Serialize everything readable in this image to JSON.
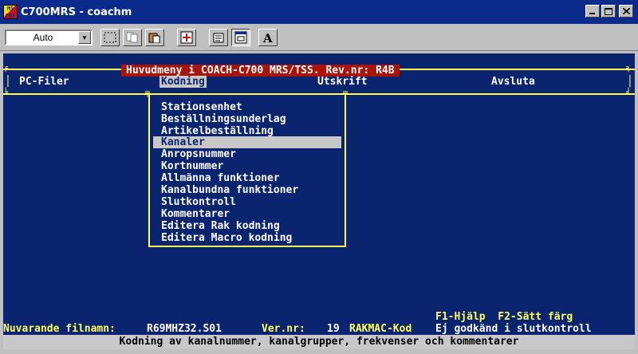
{
  "window": {
    "title": "C700MRS - coachm",
    "icon_label": "MS DOS"
  },
  "toolbar": {
    "font_size_value": "Auto",
    "buttons": [
      "mark-icon",
      "copy-icon",
      "paste-icon",
      "fullscreen-icon",
      "properties-icon",
      "background-icon",
      "font-icon"
    ]
  },
  "console": {
    "header": "Huvudmeny i COACH-C700 MRS/TSS. Rev.nr: R4B",
    "menu": [
      "PC-Filer",
      "Kodning",
      "Utskrift",
      "Avsluta"
    ],
    "dropdown": [
      "Stationsenhet",
      "Beställningsunderlag",
      "Artikelbeställning",
      "Kanaler",
      "Anropsnummer",
      "Kortnummer",
      "Allmänna funktioner",
      "Kanalbundna funktioner",
      "Slutkontroll",
      "Kommentarer",
      "Editera Rak kodning",
      "Editera Macro kodning"
    ],
    "selected_index": 3,
    "fkeys": "F1-Hjälp  F2-Sätt färg",
    "file_line": {
      "label": "Nuvarande filnamn:",
      "filename": "R69MHZ32.S01",
      "ver_label": "Ver.nr:",
      "ver_value": "19",
      "mode": "RAKMAC-Kod",
      "status": "Ej godkänd i slutkontroll"
    },
    "status_hint": "Kodning av kanalnummer, kanalgrupper, frekvenser och kommentarer"
  },
  "colors": {
    "console_bg": "#0b2470",
    "highlight_yellow": "#ffff55",
    "header_red": "#a8140a",
    "selection_gray": "#c8c8c8"
  }
}
